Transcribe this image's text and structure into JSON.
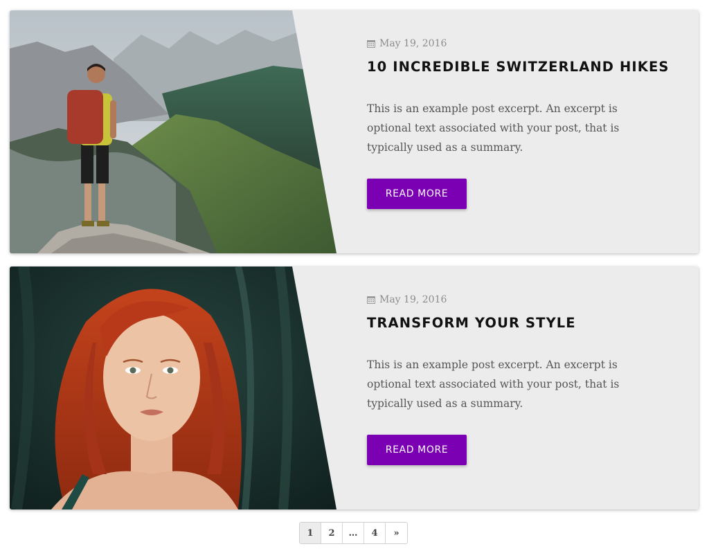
{
  "posts": [
    {
      "date": "May 19, 2016",
      "title": "10 INCREDIBLE SWITZERLAND HIKES",
      "excerpt": "This is an example post excerpt. An excerpt is optional text associated with your post, that is typically used as a summary.",
      "button_label": "READ MORE",
      "image_subject": "hiker-on-mountain-ridge"
    },
    {
      "date": "May 19, 2016",
      "title": "TRANSFORM YOUR STYLE",
      "excerpt": "This is an example post excerpt. An excerpt is optional text associated with your post, that is typically used as a summary.",
      "button_label": "READ MORE",
      "image_subject": "red-haired-woman-portrait"
    }
  ],
  "pagination": {
    "pages": [
      "1",
      "2",
      "…",
      "4",
      "»"
    ],
    "current": "1"
  },
  "colors": {
    "accent": "#7b00b4",
    "card_background": "#ececed",
    "title": "#111111",
    "excerpt": "#555555",
    "date": "#8c8c8c"
  },
  "icons": {
    "date": "calendar-icon",
    "next": "double-chevron-right"
  }
}
